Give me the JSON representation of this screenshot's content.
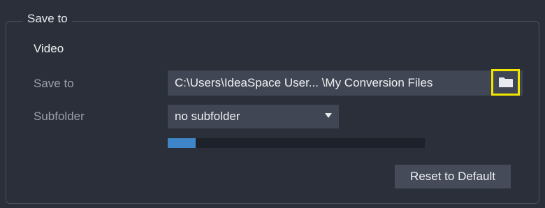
{
  "group": {
    "title": "Save to"
  },
  "section": {
    "title": "Video"
  },
  "save_to": {
    "label": "Save to",
    "path": "C:\\Users\\IdeaSpace User... \\My Conversion Files",
    "browse_icon": "folder-icon",
    "highlight_color": "#f2e600"
  },
  "subfolder": {
    "label": "Subfolder",
    "selected": "no subfolder",
    "icon": "chevron-down-icon"
  },
  "progress": {
    "fraction": 0.11,
    "color": "#3f86c8"
  },
  "actions": {
    "reset_label": "Reset to Default"
  }
}
